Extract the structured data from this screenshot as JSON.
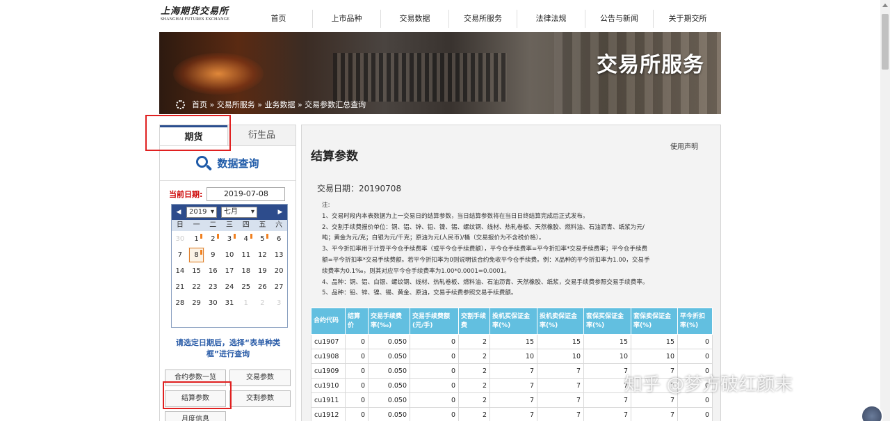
{
  "logo": {
    "cn": "上海期货交易所",
    "en": "SHANGHAI FUTURES EXCHANGE"
  },
  "nav": [
    "首页",
    "上市品种",
    "交易数据",
    "交易所服务",
    "法律法规",
    "公告与新闻",
    "关于期交所"
  ],
  "banner": {
    "title": "交易所服务",
    "breadcrumb": "首页 » 交易所服务 » 业务数据 » 交易参数汇总查询"
  },
  "left": {
    "tabs": [
      "期货",
      "衍生品"
    ],
    "search_title": "数据查询",
    "date_label": "当前日期:",
    "date_value": "2019-07-08",
    "calendar": {
      "year": "2019",
      "month": "七月",
      "weekdays": [
        "日",
        "一",
        "二",
        "三",
        "四",
        "五",
        "六"
      ],
      "days": [
        "30",
        "1",
        "2",
        "3",
        "4",
        "5",
        "6",
        "7",
        "8",
        "9",
        "10",
        "11",
        "12",
        "13",
        "14",
        "15",
        "16",
        "17",
        "18",
        "19",
        "20",
        "21",
        "22",
        "23",
        "24",
        "25",
        "26",
        "27",
        "28",
        "29",
        "30",
        "31",
        "1",
        "2",
        "3"
      ]
    },
    "hint": "请选定日期后，选择“表单种类框”进行查询",
    "buttons": [
      "合约参数一览",
      "交易参数",
      "结算参数",
      "交割参数",
      "月度信息"
    ]
  },
  "main": {
    "title": "结算参数",
    "disclaimer": "使用声明",
    "trade_date": "交易日期：20190708",
    "notes": [
      "注:",
      "1、交易时段内本表数据为上一交易日的结算参数，当日结算参数将在当日日终结算完成后正式发布。",
      "2、交割手续费报价单位：铜、铝、锌、铅、镍、锡、螺纹钢、线材、热轧卷板、天然橡胶、燃料油、石油沥青、纸浆为元/",
      "吨；黄金为元/克；白银为元/千克；原油为元(人民币)/桶（交易报价为不含税价格）。",
      "3、平今折扣率用于计算平今仓手续费率（或平今仓手续费额），平今仓手续费率=平今折扣率*交易手续费率；平今仓手续费",
      "额=平今折扣率*交易手续费额。若平今折扣率为0则说明该合约免收平今仓手续费。例：X品种的平今折扣率为1.00，交易手",
      "续费率为0.1‰，则其对应平今仓手续费率为1.00*0.0001=0.0001。",
      "4、品种：铜、铝、白银、螺纹钢、线材、热轧卷板、燃料油、石油沥青、天然橡胶、纸浆，交易手续费参照交易手续费率。",
      "5、品种：铅、锌、镍、锡、黄金、原油，交易手续费参照交易手续费额。"
    ],
    "table": {
      "headers": [
        "合约代码",
        "结算价",
        "交易手续费率(‰)",
        "交易手续费额(元/手)",
        "交割手续费",
        "投机买保证金率(%)",
        "投机卖保证金率(%)",
        "套保买保证金率(%)",
        "套保卖保证金率(%)",
        "平今折扣率(%)"
      ],
      "rows": [
        [
          "cu1907",
          "0",
          "0.050",
          "0",
          "2",
          "15",
          "15",
          "15",
          "15",
          "0"
        ],
        [
          "cu1908",
          "0",
          "0.050",
          "0",
          "2",
          "10",
          "10",
          "10",
          "10",
          "0"
        ],
        [
          "cu1909",
          "0",
          "0.050",
          "0",
          "2",
          "7",
          "7",
          "7",
          "7",
          "0"
        ],
        [
          "cu1910",
          "0",
          "0.050",
          "0",
          "2",
          "7",
          "7",
          "7",
          "7",
          "0"
        ],
        [
          "cu1911",
          "0",
          "0.050",
          "0",
          "2",
          "7",
          "7",
          "7",
          "7",
          "0"
        ],
        [
          "cu1912",
          "0",
          "0.050",
          "0",
          "2",
          "7",
          "7",
          "7",
          "7",
          "0"
        ]
      ]
    }
  },
  "watermark": "知乎 @梦方破红颜末",
  "colors": {
    "table_header": "#62bfe0",
    "calendar_header": "#2d4c8c",
    "highlight": "#e02020",
    "accent": "#1e5aa8"
  }
}
